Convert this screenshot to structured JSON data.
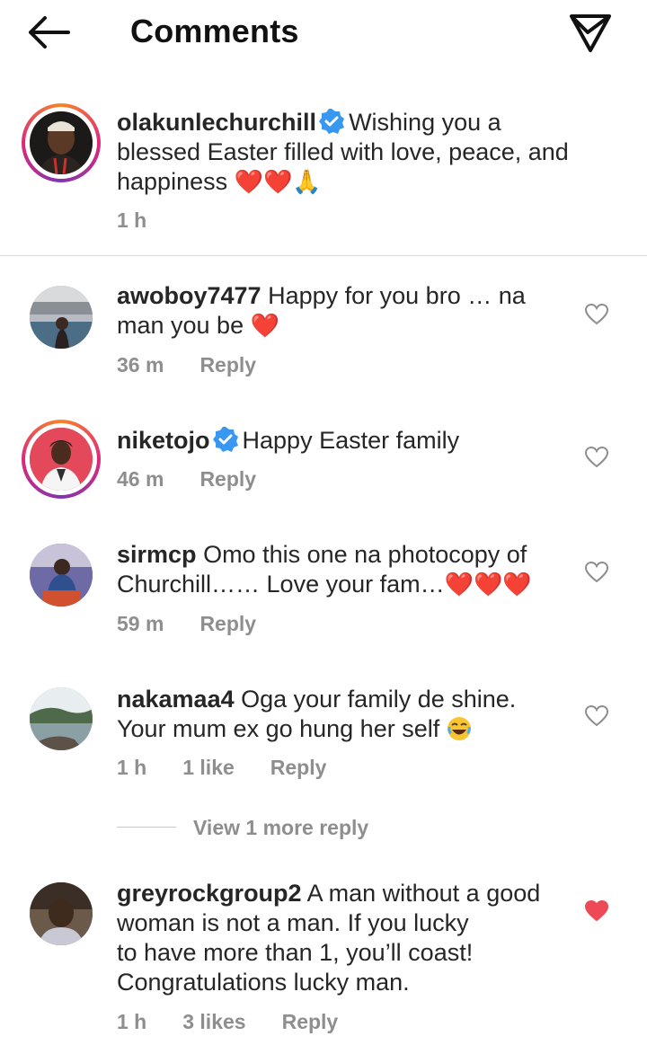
{
  "header": {
    "title": "Comments"
  },
  "caption": {
    "username": "olakunlechurchill",
    "text_line1": "Wishing you a",
    "text_line2": "blessed Easter filled with love, peace, and",
    "text_line3": "happiness",
    "emojis": "❤️❤️🙏",
    "time": "1 h"
  },
  "comments": [
    {
      "username": "awoboy7477",
      "line1": "Happy for you bro … na",
      "line2": "man you be",
      "emoji": "❤️",
      "time": "36 m",
      "likes": "",
      "reply_label": "Reply",
      "liked": false
    },
    {
      "username": "niketojo",
      "line1": "Happy Easter family",
      "time": "46 m",
      "likes": "",
      "reply_label": "Reply",
      "liked": false
    },
    {
      "username": "sirmcp",
      "line1": "Omo this one na photocopy of",
      "line2": "Churchill…… Love your fam…",
      "emoji": "❤️❤️❤️",
      "time": "59 m",
      "likes": "",
      "reply_label": "Reply",
      "liked": false
    },
    {
      "username": "nakamaa4",
      "line1": "Oga your  family  de  shine.",
      "line2": "Your mum  ex  go hung her self",
      "time": "1 h",
      "likes": "1 like",
      "reply_label": "Reply",
      "liked": false
    },
    {
      "username": "greyrockgroup2",
      "line1": "A man without a good",
      "line2": "woman is not a man. If you lucky",
      "line3": "to have more than 1, you’ll coast!",
      "line4": "Congratulations lucky man.",
      "time": "1 h",
      "likes": "3 likes",
      "reply_label": "Reply",
      "liked": true
    }
  ],
  "view_more_replies": "View 1 more reply",
  "colors": {
    "liked_heart": "#ed4956",
    "verified": "#3897f0",
    "meta_gray": "#8e8e8e"
  }
}
